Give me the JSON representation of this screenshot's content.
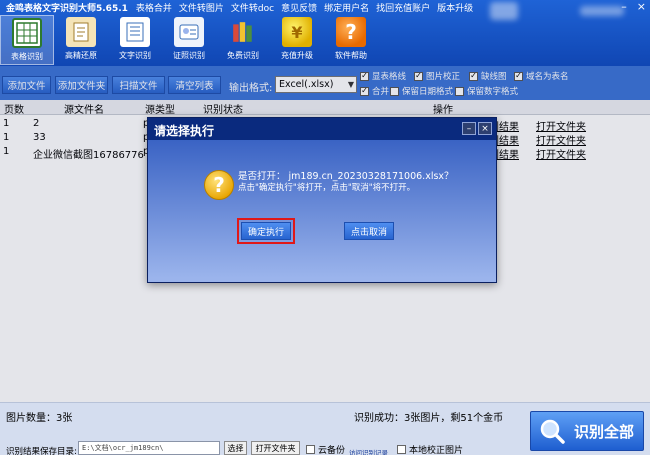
{
  "app": {
    "title": "金鸣表格文字识别大师5.65.1"
  },
  "menu": [
    "表格合并",
    "文件转图片",
    "文件转doc",
    "意见反馈",
    "绑定用户名",
    "找回充值账户",
    "版本升级"
  ],
  "window_controls": {
    "minimize": "–",
    "close": "×"
  },
  "toolbar": [
    {
      "label": "表格识别",
      "icon": "table-icon",
      "active": true
    },
    {
      "label": "高精还原",
      "icon": "document-icon",
      "active": false
    },
    {
      "label": "文字识别",
      "icon": "text-doc-icon",
      "active": false
    },
    {
      "label": "证照识别",
      "icon": "id-card-icon",
      "active": false
    },
    {
      "label": "免费识别",
      "icon": "books-icon",
      "active": false
    },
    {
      "label": "充值升级",
      "icon": "coin-icon",
      "active": false
    },
    {
      "label": "软件帮助",
      "icon": "help-icon",
      "active": false
    }
  ],
  "actions": {
    "add_file": "添加文件",
    "add_folder": "添加文件夹",
    "scan_file": "扫描文件",
    "clear_list": "清空列表"
  },
  "output": {
    "label": "输出格式:",
    "selected": "Excel(.xlsx)"
  },
  "options": [
    {
      "label": "显表格线",
      "checked": true
    },
    {
      "label": "图片校正",
      "checked": true
    },
    {
      "label": "缺线图",
      "checked": true
    },
    {
      "label": "域名为表名",
      "checked": true
    },
    {
      "label": "合并",
      "checked": true
    },
    {
      "label": "保留日期格式",
      "checked": false
    },
    {
      "label": "保留数字格式",
      "checked": false
    }
  ],
  "table": {
    "headers": {
      "pages": "页数",
      "source": "源文件名",
      "type": "源类型",
      "status": "识别状态",
      "ops": "操作"
    },
    "rows": [
      {
        "pages": "1",
        "source": "2",
        "type": "p",
        "view_result": "识别结果",
        "open_folder": "打开文件夹"
      },
      {
        "pages": "1",
        "source": "33",
        "type": "p",
        "view_result": "识别结果",
        "open_folder": "打开文件夹"
      },
      {
        "pages": "1",
        "source": "企业微信截图16786776",
        "type": "p",
        "view_result": "识别结果",
        "open_folder": "打开文件夹"
      }
    ]
  },
  "dialog": {
    "title": "请选择执行",
    "min": "–",
    "close": "×",
    "icon": "?",
    "question": "是否打开：  jm189.cn_20230328171006.xlsx？",
    "hint": "点击\"确定执行\"将打开，点击\"取消\"将不打开。",
    "confirm": "确定执行",
    "cancel": "点击取消"
  },
  "status": {
    "image_count": "图片数量：3张",
    "success": "识别成功：3张图片，剩51个金币"
  },
  "save": {
    "label": "识别结果保存目录:",
    "path": "E:\\文档\\ocr_jm189cn\\",
    "choose": "选择",
    "open_folder": "打开文件夹",
    "cloud_backup": "云备份",
    "cloud_backup_checked": false,
    "visit_records": "访问识别记录",
    "local_correct": "本地校正图片",
    "local_correct_checked": false
  },
  "recognize_all": "识别全部",
  "colors": {
    "toolbar_blue": "#1a56c8",
    "dialog_header": "#0a2a7e",
    "confirm_outline": "#e01818"
  }
}
